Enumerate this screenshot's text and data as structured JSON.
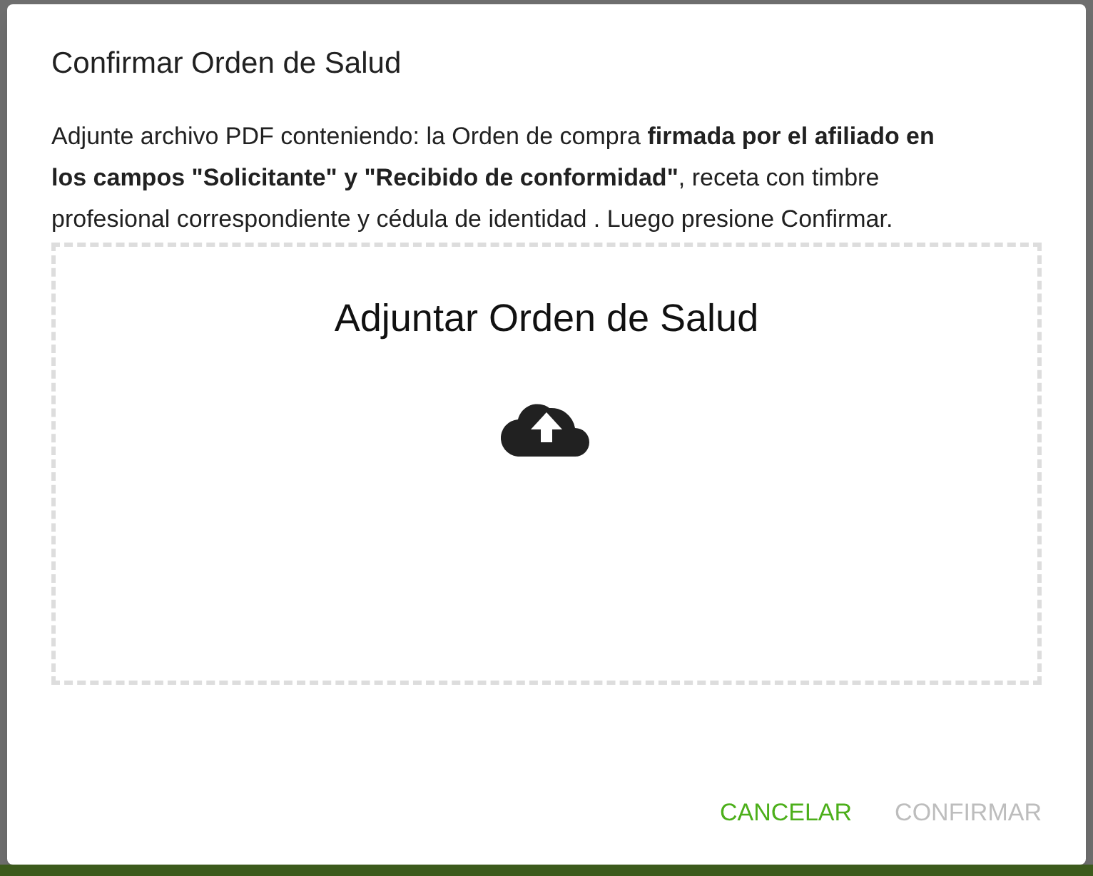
{
  "dialog": {
    "title": "Confirmar Orden de Salud",
    "description": "Adjunte archivo PDF conteniendo: la Orden de compra **firmada por el afiliado en los campos \"Solicitante\" y \"Recibido de conformidad\"**, receta con timbre profesional correspondiente y cédula de identidad . Luego presione Confirmar.",
    "dropzone": {
      "label": "Adjuntar Orden de Salud"
    },
    "buttons": [
      {
        "label": "CANCELAR",
        "disabled": false
      },
      {
        "label": "CONFIRMAR",
        "disabled": true
      }
    ]
  }
}
